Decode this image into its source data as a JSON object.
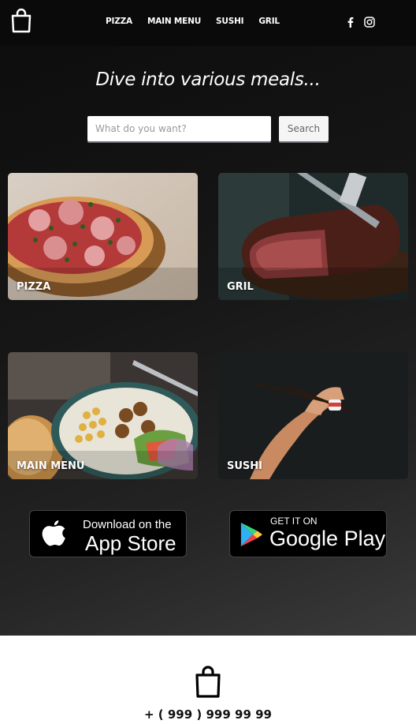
{
  "nav": {
    "links": [
      "PIZZA",
      "MAIN MENU",
      "SUSHI",
      "GRIL"
    ],
    "social": [
      "facebook-icon",
      "instagram-icon"
    ]
  },
  "hero": {
    "title": "Dive into various meals...",
    "search_placeholder": "What do you want?",
    "search_button": "Search"
  },
  "categories": [
    {
      "label": "PIZZA"
    },
    {
      "label": "GRIL"
    },
    {
      "label": "MAIN MENU"
    },
    {
      "label": "SUSHI"
    }
  ],
  "stores": {
    "apple": {
      "small": "Download on the",
      "big": "App Store"
    },
    "google": {
      "small": "GET IT ON",
      "big": "Google Play"
    }
  },
  "footer": {
    "phone": "+ ( 999 ) 999 99 99"
  },
  "colors": {
    "nav_bg": "#0a0a0a",
    "page_bg_start": "#0c0c0c",
    "page_bg_end": "#3a3a3a",
    "footer_bg": "#ffffff"
  }
}
